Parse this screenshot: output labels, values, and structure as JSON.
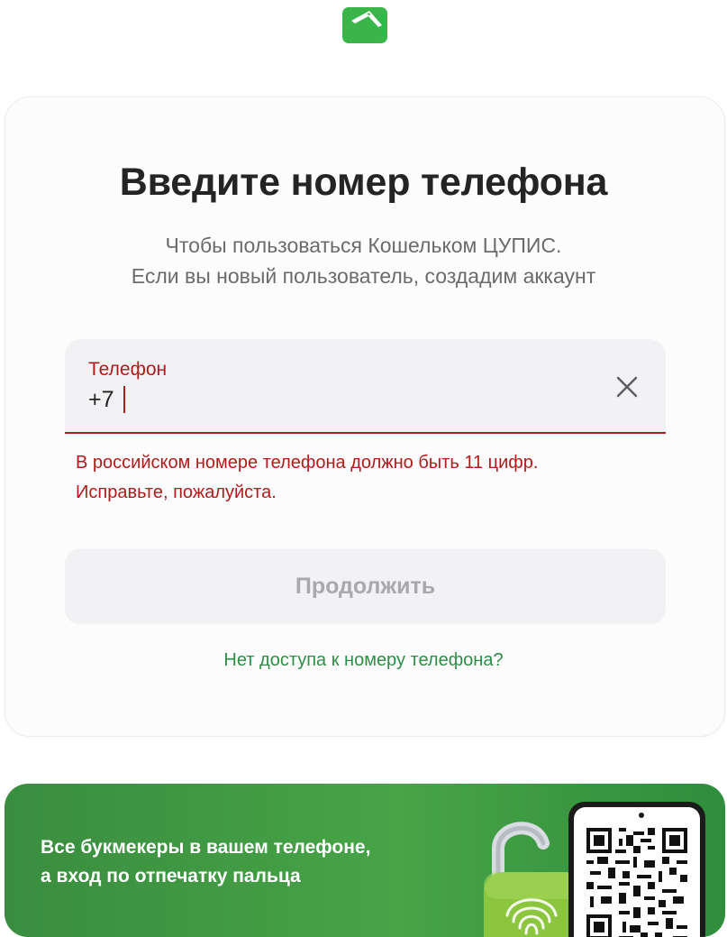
{
  "logo": {
    "icon": "wallet-logo-icon",
    "color": "#39b54a"
  },
  "heading": {
    "title": "Введите номер телефона",
    "subtitle_line1": "Чтобы пользоваться Кошельком ЦУПИС.",
    "subtitle_line2": "Если вы новый пользователь, создадим аккаунт"
  },
  "phone_field": {
    "label": "Телефон",
    "value": "+7",
    "clear_icon": "close-icon"
  },
  "error": {
    "line1": "В российском номере телефона должно быть 11 цифр.",
    "line2": "Исправьте, пожалуйста."
  },
  "continue_button": {
    "label": "Продолжить",
    "state": "disabled"
  },
  "no_access_link": "Нет доступа к номеру телефона?",
  "banner": {
    "line1": "Все букмекеры в вашем телефоне,",
    "line2": "а вход по отпечатку пальца",
    "lock_icon": "fingerprint-lock-icon",
    "qr_icon": "qr-code-icon"
  },
  "colors": {
    "error": "#b01b1b",
    "accent_green": "#2f8d48",
    "banner_green": "#47a447",
    "title": "#242424",
    "muted": "#6b6b6b"
  }
}
